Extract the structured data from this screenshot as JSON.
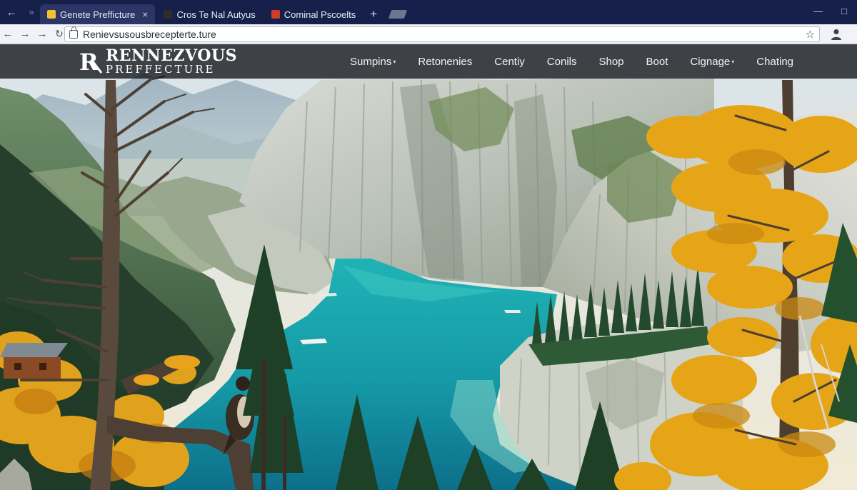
{
  "browser": {
    "tabs": [
      {
        "label": "Genete Prefficture",
        "favicon_color": "#f2c230",
        "active": true,
        "close": "×"
      },
      {
        "label": "Cros Te Nal Autyus",
        "favicon_color": "#2d2d2d",
        "active": false,
        "close": ""
      },
      {
        "label": "Cominal Pscoelts",
        "favicon_color": "#d23a2a",
        "active": false,
        "close": ""
      }
    ],
    "new_tab": "+",
    "url": "Renievsusousbrecepterte.ture"
  },
  "site": {
    "brand": {
      "monogram": "R",
      "line1": "RENNEZVOUS",
      "line2": "PREFFECTURE"
    },
    "menu": [
      {
        "label": "Sumpins",
        "has_caret": true
      },
      {
        "label": "Retonenies",
        "has_caret": false
      },
      {
        "label": "Centiy",
        "has_caret": false
      },
      {
        "label": "Conils",
        "has_caret": false
      },
      {
        "label": "Shop",
        "has_caret": false
      },
      {
        "label": "Boot",
        "has_caret": false
      },
      {
        "label": "Cignage",
        "has_caret": true
      },
      {
        "label": "Chating",
        "has_caret": false
      }
    ]
  },
  "icons": {
    "back": "arrow-left-icon",
    "forward": "arrow-right-icon",
    "reload": "reload-icon",
    "lock": "lock-icon",
    "bookmark": "star-icon",
    "profile": "person-icon"
  },
  "colors": {
    "tab_strip": "#17204a",
    "toolbar": "#f1f3f7",
    "nav_bar": "#141619",
    "water": "#1aa8b0",
    "foliage_gold": "#e8a317"
  }
}
